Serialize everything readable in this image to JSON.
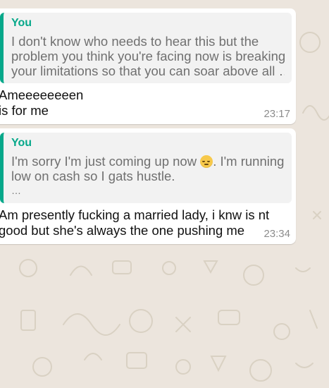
{
  "messages": [
    {
      "quote_author": "You",
      "quote_lines": [
        "I don't know who needs to hear this but the",
        "problem you think you're facing now is breaking",
        "your limitations so that you can soar above all …"
      ],
      "text_lines": [
        "Ameeeeeeeen",
        "is for me"
      ],
      "time": "23:17"
    },
    {
      "quote_author": "You",
      "quote_line1_before": "I'm sorry I'm just coming up now",
      "quote_line1_after": ". I'm running",
      "quote_emoji": "pensive-face-emoji",
      "quote_line2": "low on cash so I gats hustle.",
      "quote_line3": "…",
      "text_lines": [
        "Am presently fucking a married lady, i knw is nt",
        "good but she's always the one pushing me"
      ],
      "time": "23:34"
    }
  ],
  "colors": {
    "accent": "#06a88a",
    "chat_background": "#ece5dd",
    "bubble": "#ffffff",
    "quote_background": "#f2f2f2"
  }
}
